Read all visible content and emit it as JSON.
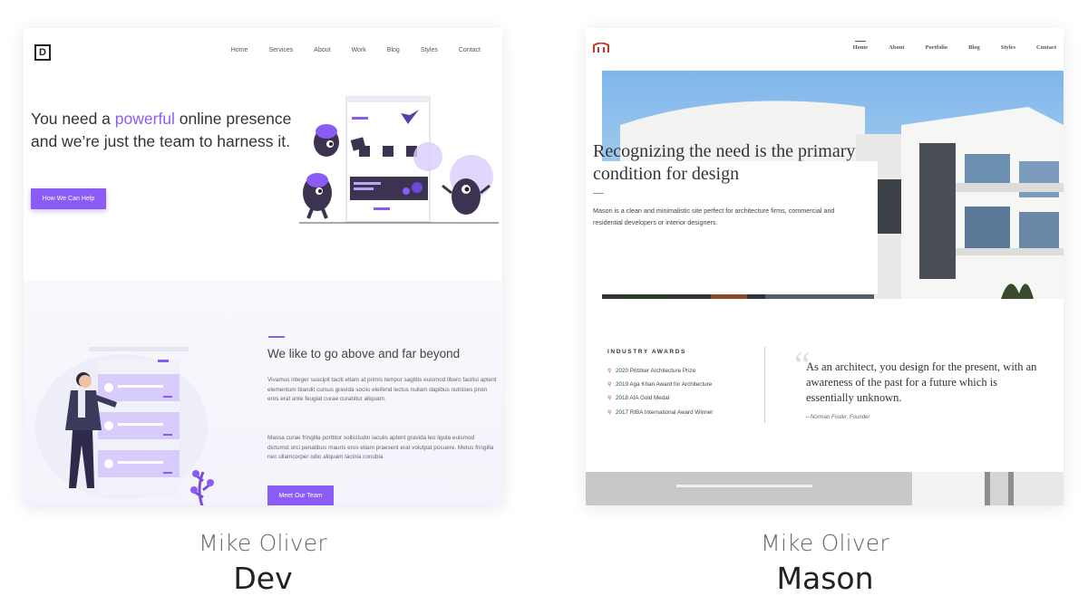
{
  "dev": {
    "logo_letter": "D",
    "nav": [
      "Home",
      "Services",
      "About",
      "Work",
      "Blog",
      "Styles",
      "Contact"
    ],
    "hero_title_part1": "You need a ",
    "hero_title_accent": "powerful",
    "hero_title_part2": " online presence and we’re just the team to harness it.",
    "hero_button": "How We Can Help",
    "section_title": "We like to go above and far beyond",
    "para1": "Vivamus integer suscipit taciti etiam at primis tempor sagittis euismod libero facilisi aptent elementum blandit cursus gravida sociis eleifend lectus nullam dapibus nutricies proin eros erat ante feugiat curae curabitur aliquam.",
    "para2": "Massa curae fringilla porttitor sollicitudin iaculis aptent gravida leo ligula euismod dictumst orci penatibus mauris eros etiam praesent erat volutpat posuere. Metus fringilla nec ullamcorper odio aliquam lacinia conubia",
    "team_button": "Meet Our Team",
    "accent_color": "#8a5cf5"
  },
  "mason": {
    "nav": [
      "Home",
      "About",
      "Portfolio",
      "Blog",
      "Styles",
      "Contact"
    ],
    "hero_title": "Recognizing the need is the primary condition for design",
    "hero_desc": "Mason is a clean and minimalistic site perfect for architecture firms, commercial and residential developers or interior designers.",
    "awards_title": "INDUSTRY AWARDS",
    "awards": [
      "2020 Pritzker Architecture Prize",
      "2019 Aga Khan Award for Architecture",
      "2018 AIA Gold Medal",
      "2017 RIBA International Award Winner"
    ],
    "quote": "As an architect, you design for the present, with an awareness of the past for a future which is essentially unknown.",
    "quote_author": "– Norman Foster, Founder",
    "accent_color": "#c0392b"
  },
  "captions": [
    {
      "author": "Mike Oliver",
      "theme": "Dev"
    },
    {
      "author": "Mike Oliver",
      "theme": "Mason"
    }
  ]
}
